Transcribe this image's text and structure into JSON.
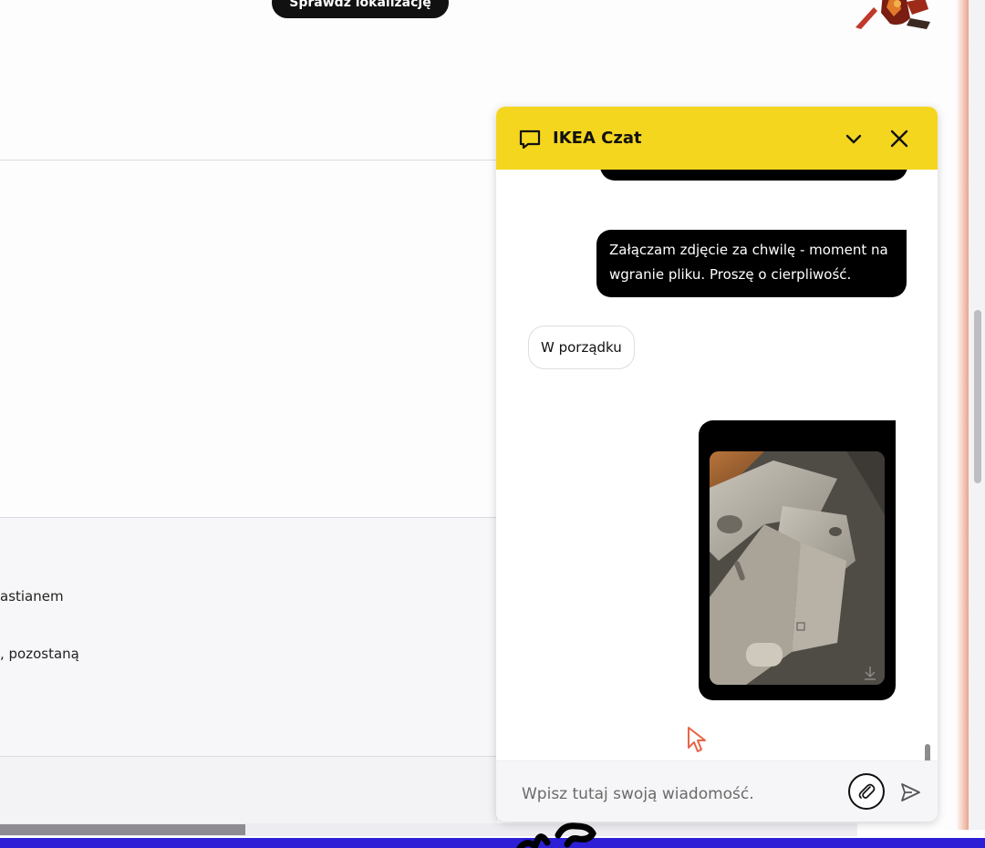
{
  "page": {
    "top_button_label": "Sprawdź lokalizację",
    "text_line_1": "astianem",
    "text_line_2": ", pozostaną"
  },
  "chat": {
    "title": "IKEA Czat",
    "icons": {
      "header": "chat-bubble-icon",
      "minimize": "chevron-down-icon",
      "close": "close-icon",
      "attach": "paperclip-icon",
      "send": "send-icon",
      "download": "download-icon"
    },
    "messages": [
      {
        "from": "user",
        "text": "Załączam zdjęcie za chwilę - moment na wgranie pliku. Proszę o cierpliwość."
      },
      {
        "from": "agent",
        "text": "W porządku"
      },
      {
        "from": "user",
        "type": "image"
      }
    ],
    "input": {
      "placeholder": "Wpisz tutaj swoją wiadomość."
    }
  },
  "colors": {
    "header_yellow": "#f4d61f",
    "bubble_black": "#000000",
    "taskbar_blue": "#2c1fd6"
  }
}
